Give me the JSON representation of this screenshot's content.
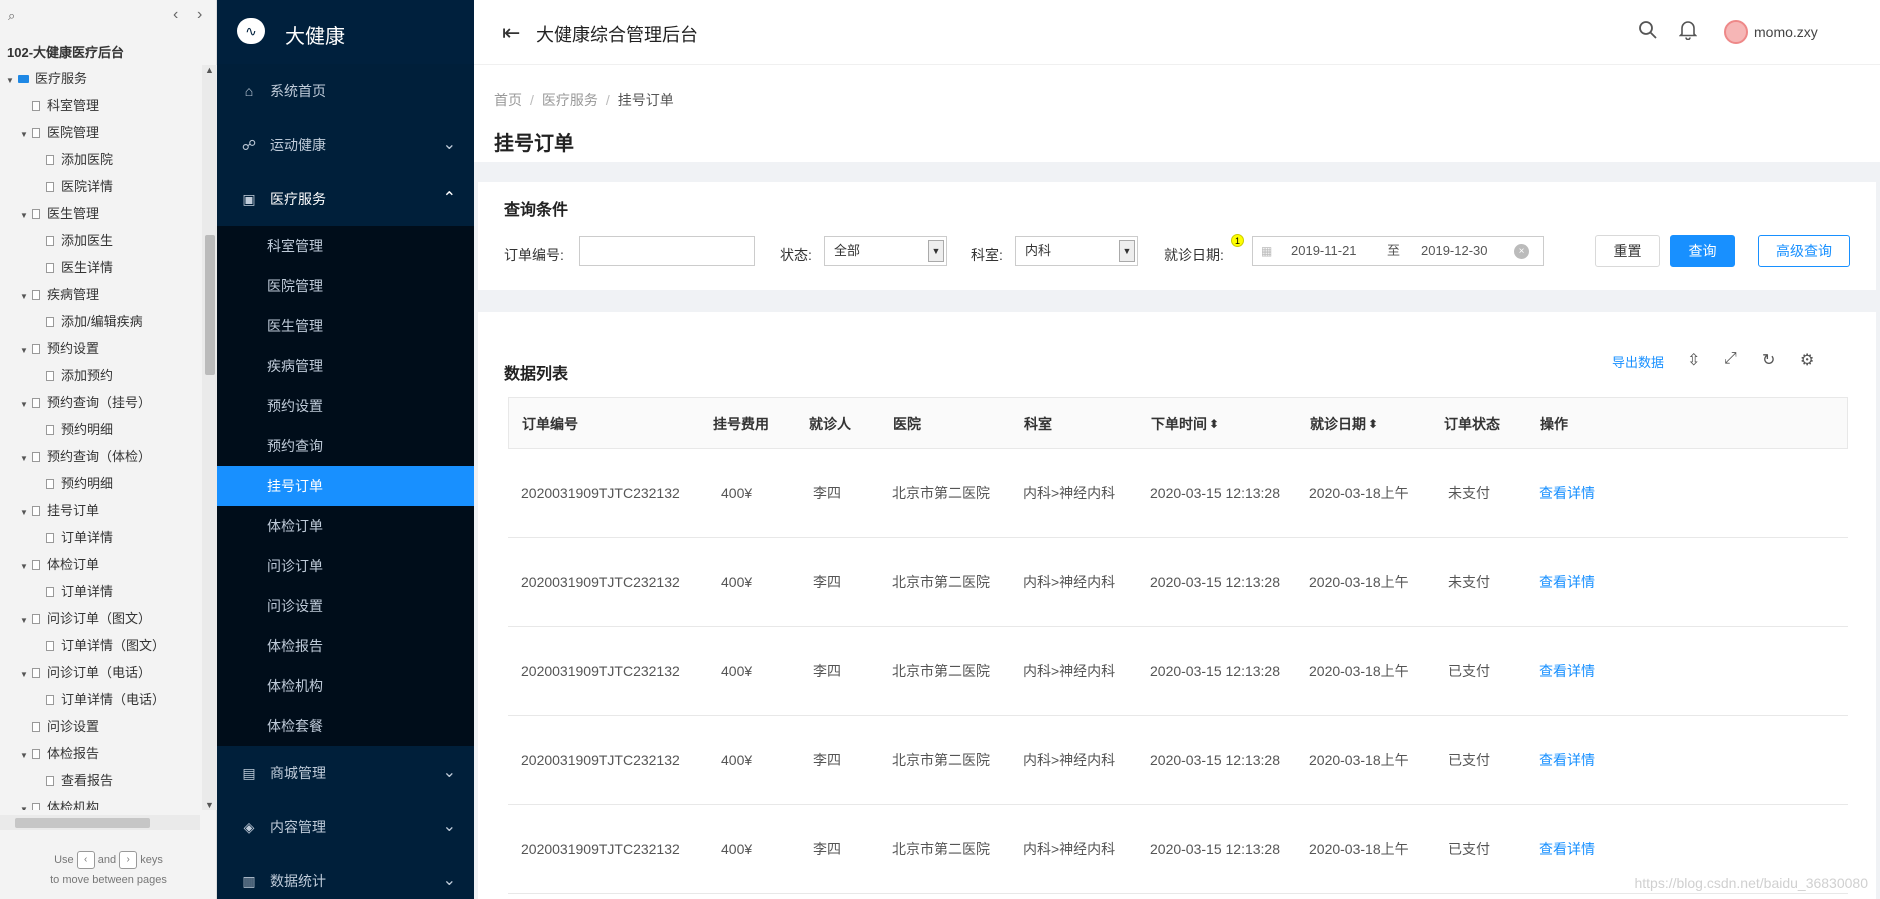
{
  "rp": {
    "search_icon": "⌕",
    "prev": "‹",
    "next": "›",
    "project": "102-大健康医疗后台",
    "tree": [
      {
        "label": "医疗服务",
        "level": 0,
        "folder": true,
        "expanded": true
      },
      {
        "label": "科室管理",
        "level": 1
      },
      {
        "label": "医院管理",
        "level": 1,
        "expanded": true
      },
      {
        "label": "添加医院",
        "level": 2
      },
      {
        "label": "医院详情",
        "level": 2
      },
      {
        "label": "医生管理",
        "level": 1,
        "expanded": true
      },
      {
        "label": "添加医生",
        "level": 2
      },
      {
        "label": "医生详情",
        "level": 2
      },
      {
        "label": "疾病管理",
        "level": 1,
        "expanded": true
      },
      {
        "label": "添加/编辑疾病",
        "level": 2
      },
      {
        "label": "预约设置",
        "level": 1,
        "expanded": true
      },
      {
        "label": "添加预约",
        "level": 2
      },
      {
        "label": "预约查询（挂号）",
        "level": 1,
        "expanded": true
      },
      {
        "label": "预约明细",
        "level": 2
      },
      {
        "label": "预约查询（体检）",
        "level": 1,
        "expanded": true
      },
      {
        "label": "预约明细",
        "level": 2
      },
      {
        "label": "挂号订单",
        "level": 1,
        "expanded": true
      },
      {
        "label": "订单详情",
        "level": 2
      },
      {
        "label": "体检订单",
        "level": 1,
        "expanded": true
      },
      {
        "label": "订单详情",
        "level": 2
      },
      {
        "label": "问诊订单（图文）",
        "level": 1,
        "expanded": true
      },
      {
        "label": "订单详情（图文）",
        "level": 2
      },
      {
        "label": "问诊订单（电话）",
        "level": 1,
        "expanded": true
      },
      {
        "label": "订单详情（电话）",
        "level": 2
      },
      {
        "label": "问诊设置",
        "level": 1
      },
      {
        "label": "体检报告",
        "level": 1,
        "expanded": true
      },
      {
        "label": "查看报告",
        "level": 2
      },
      {
        "label": "体检机构",
        "level": 1,
        "expanded": true
      }
    ],
    "hint_use": "Use",
    "hint_and": "and",
    "hint_keys": "keys",
    "hint_line2": "to move between pages"
  },
  "sidebar": {
    "brand": "大健康",
    "items": [
      {
        "label": "系统首页",
        "icon": "home-icon",
        "glyph": "⌂"
      },
      {
        "label": "运动健康",
        "icon": "runner-icon",
        "glyph": "☍",
        "arrow": "⌄"
      },
      {
        "label": "医疗服务",
        "icon": "medkit-icon",
        "glyph": "▣",
        "arrow": "⌃"
      }
    ],
    "subitems": [
      "科室管理",
      "医院管理",
      "医生管理",
      "疾病管理",
      "预约设置",
      "预约查询",
      "挂号订单",
      "体检订单",
      "问诊订单",
      "问诊设置",
      "体检报告",
      "体检机构",
      "体检套餐"
    ],
    "active_sub": "挂号订单",
    "bottom_items": [
      {
        "label": "商城管理",
        "icon": "shop-icon",
        "glyph": "▤",
        "arrow": "⌄"
      },
      {
        "label": "内容管理",
        "icon": "box-icon",
        "glyph": "◈",
        "arrow": "⌄"
      },
      {
        "label": "数据统计",
        "icon": "chart-icon",
        "glyph": "▥",
        "arrow": "⌄"
      }
    ]
  },
  "header": {
    "title": "大健康综合管理后台",
    "user": "momo.zxy"
  },
  "breadcrumb": {
    "home": "首页",
    "section": "医疗服务",
    "current": "挂号订单"
  },
  "page_title": "挂号订单",
  "query": {
    "title": "查询条件",
    "order_no_label": "订单编号:",
    "order_no_value": "",
    "status_label": "状态:",
    "status_value": "全部",
    "dept_label": "科室:",
    "dept_value": "内科",
    "date_label": "就诊日期:",
    "badge": "1",
    "date_from": "2019-11-21",
    "date_sep": "至",
    "date_to": "2019-12-30",
    "reset": "重置",
    "search": "查询",
    "advanced": "高级查询"
  },
  "list": {
    "title": "数据列表",
    "export": "导出数据",
    "columns": [
      "订单编号",
      "挂号费用",
      "就诊人",
      "医院",
      "科室",
      "下单时间",
      "就诊日期",
      "订单状态",
      "操作"
    ],
    "rows": [
      [
        "2020031909TJTC232132",
        "400¥",
        "李四",
        "北京市第二医院",
        "内科>神经内科",
        "2020-03-15 12:13:28",
        "2020-03-18上午",
        "未支付",
        "查看详情"
      ],
      [
        "2020031909TJTC232132",
        "400¥",
        "李四",
        "北京市第二医院",
        "内科>神经内科",
        "2020-03-15 12:13:28",
        "2020-03-18上午",
        "未支付",
        "查看详情"
      ],
      [
        "2020031909TJTC232132",
        "400¥",
        "李四",
        "北京市第二医院",
        "内科>神经内科",
        "2020-03-15 12:13:28",
        "2020-03-18上午",
        "已支付",
        "查看详情"
      ],
      [
        "2020031909TJTC232132",
        "400¥",
        "李四",
        "北京市第二医院",
        "内科>神经内科",
        "2020-03-15 12:13:28",
        "2020-03-18上午",
        "已支付",
        "查看详情"
      ],
      [
        "2020031909TJTC232132",
        "400¥",
        "李四",
        "北京市第二医院",
        "内科>神经内科",
        "2020-03-15 12:13:28",
        "2020-03-18上午",
        "已支付",
        "查看详情"
      ]
    ]
  },
  "watermark": "https://blog.csdn.net/baidu_36830080",
  "colors": {
    "sidebar_bg": "#001528",
    "accent": "#1890ff"
  }
}
